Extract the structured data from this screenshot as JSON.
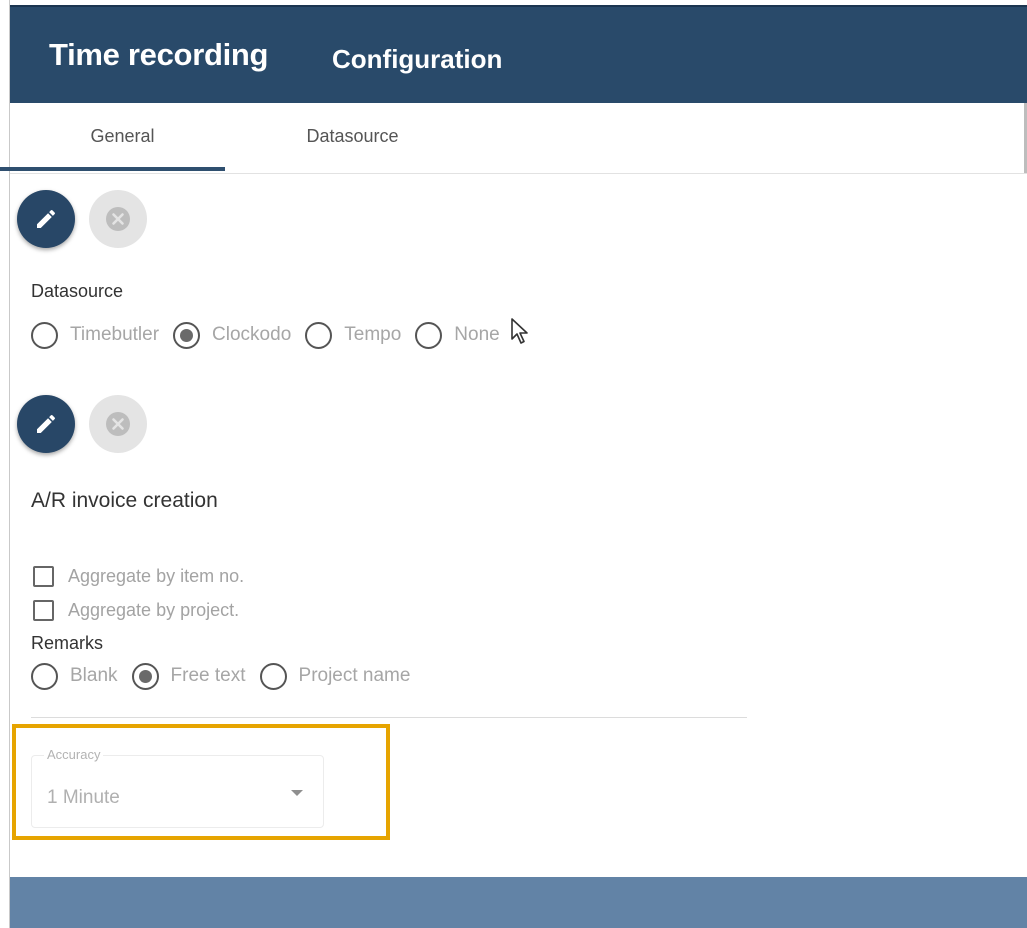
{
  "header": {
    "title": "Time recording",
    "subtitle": "Configuration"
  },
  "tabs": [
    {
      "label": "General",
      "active": true
    },
    {
      "label": "Datasource",
      "active": false
    }
  ],
  "datasource_section": {
    "label": "Datasource",
    "options": [
      {
        "label": "Timebutler",
        "checked": false
      },
      {
        "label": "Clockodo",
        "checked": true
      },
      {
        "label": "Tempo",
        "checked": false
      },
      {
        "label": "None",
        "checked": false
      }
    ]
  },
  "invoice_section": {
    "heading": "A/R invoice creation",
    "checkboxes": [
      {
        "label": "Aggregate by item no.",
        "checked": false
      },
      {
        "label": "Aggregate by project.",
        "checked": false
      }
    ],
    "remarks_label": "Remarks",
    "remarks_options": [
      {
        "label": "Blank",
        "checked": false
      },
      {
        "label": "Free text",
        "checked": true
      },
      {
        "label": "Project name",
        "checked": false
      }
    ]
  },
  "accuracy": {
    "label": "Accuracy",
    "value": "1 Minute"
  },
  "icons": {
    "edit": "pencil-icon",
    "cancel": "close-circle-icon",
    "dropdown": "chevron-down-icon",
    "cursor": "mouse-pointer-icon"
  },
  "colors": {
    "header_bg": "#294a6a",
    "edit_button": "#284767",
    "highlight": "#e6a400",
    "bottom_bar": "#6283a6"
  }
}
